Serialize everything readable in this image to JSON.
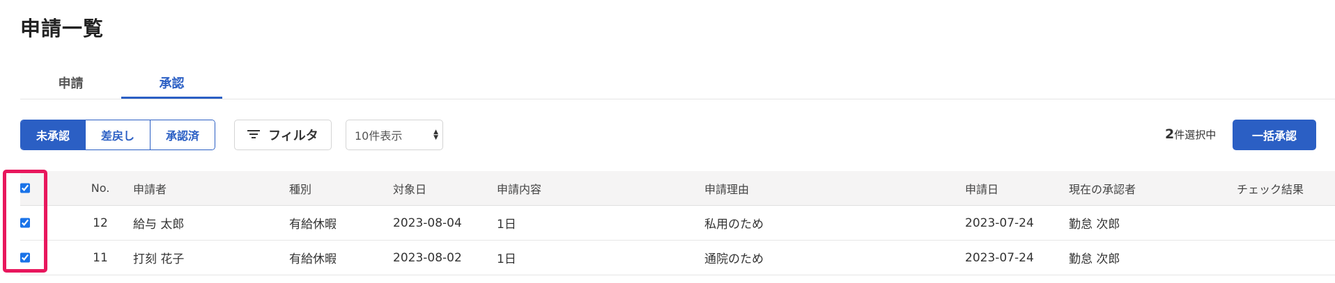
{
  "page": {
    "title": "申請一覧"
  },
  "tabs": [
    {
      "label": "申請",
      "active": false
    },
    {
      "label": "承認",
      "active": true
    }
  ],
  "status_filter": [
    {
      "label": "未承認",
      "active": true
    },
    {
      "label": "差戻し",
      "active": false
    },
    {
      "label": "承認済",
      "active": false
    }
  ],
  "toolbar": {
    "filter_label": "フィルタ",
    "filter_icon": "filter-lines-icon",
    "page_size": "10件表示",
    "selected_count": "2",
    "selected_suffix": "件選択中",
    "bulk_approve_label": "一括承認"
  },
  "table": {
    "columns": [
      "No.",
      "申請者",
      "種別",
      "対象日",
      "申請内容",
      "申請理由",
      "申請日",
      "現在の承認者",
      "チェック結果"
    ],
    "header_checked": true,
    "rows": [
      {
        "checked": true,
        "no": "12",
        "applicant": "給与 太郎",
        "type": "有給休暇",
        "target_date": "2023-08-04",
        "content": "1日",
        "reason": "私用のため",
        "applied_date": "2023-07-24",
        "approver": "勤怠 次郎",
        "check_result": ""
      },
      {
        "checked": true,
        "no": "11",
        "applicant": "打刻 花子",
        "type": "有給休暇",
        "target_date": "2023-08-02",
        "content": "1日",
        "reason": "通院のため",
        "applied_date": "2023-07-24",
        "approver": "勤怠 次郎",
        "check_result": ""
      }
    ]
  },
  "colors": {
    "accent": "#2b5fc4",
    "highlight": "#e8175d",
    "checkbox": "#1a73e8"
  }
}
